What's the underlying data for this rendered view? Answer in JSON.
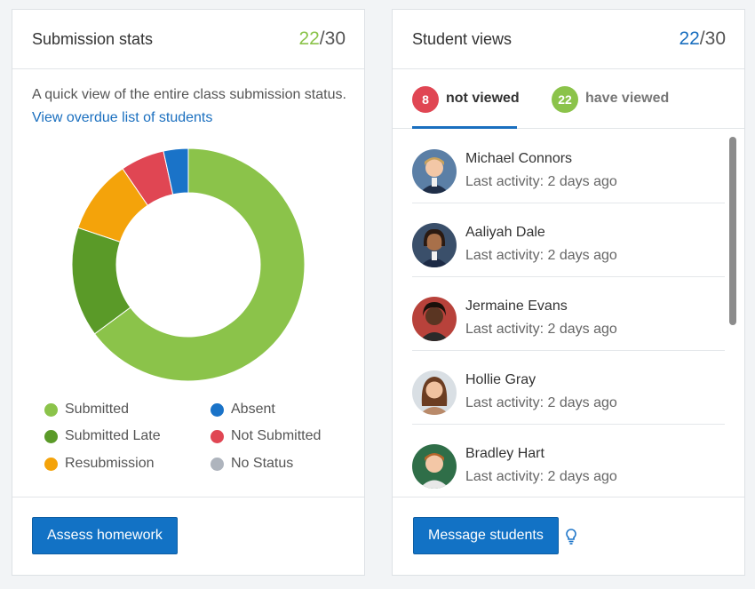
{
  "submission_card": {
    "title": "Submission stats",
    "count": {
      "done": "22",
      "separator": "/",
      "total": "30"
    },
    "description": "A quick view of the entire class submission status.",
    "overdue_link": "View overdue list of students",
    "legend": [
      {
        "label": "Submitted",
        "color": "#8bc34a"
      },
      {
        "label": "Absent",
        "color": "#1a73c8"
      },
      {
        "label": "Submitted Late",
        "color": "#5a9a28"
      },
      {
        "label": "Not Submitted",
        "color": "#e04653"
      },
      {
        "label": "Resubmission",
        "color": "#f4a30a"
      },
      {
        "label": "No Status",
        "color": "#aeb4bd"
      }
    ],
    "donut": [
      {
        "label": "Submitted",
        "value": 17,
        "color": "#8bc34a"
      },
      {
        "label": "Submitted Late",
        "value": 4,
        "color": "#5a9a28"
      },
      {
        "label": "Resubmission",
        "value": 2.7,
        "color": "#f4a30a"
      },
      {
        "label": "Not Submitted",
        "value": 1.6,
        "color": "#e04653"
      },
      {
        "label": "Absent",
        "value": 0.9,
        "color": "#1a73c8"
      }
    ],
    "assess_button": "Assess homework"
  },
  "views_card": {
    "title": "Student views",
    "count": {
      "done": "22",
      "separator": "/",
      "total": "30"
    },
    "tabs": [
      {
        "count": "8",
        "label": "not viewed",
        "badge_color": "#e04653",
        "active": true
      },
      {
        "count": "22",
        "label": "have viewed",
        "badge_color": "#8bc34a",
        "active": false
      }
    ],
    "students": [
      {
        "name": "Michael Connors",
        "activity": "Last activity: 2 days ago",
        "avatar_bg": "#5b7fa6"
      },
      {
        "name": "Aaliyah Dale",
        "activity": "Last activity: 2 days ago",
        "avatar_bg": "#3a4f6a"
      },
      {
        "name": "Jermaine Evans",
        "activity": "Last activity: 2 days ago",
        "avatar_bg": "#b8423b"
      },
      {
        "name": "Hollie Gray",
        "activity": "Last activity: 2 days ago",
        "avatar_bg": "#d9dfe4"
      },
      {
        "name": "Bradley Hart",
        "activity": "Last activity: 2 days ago",
        "avatar_bg": "#2f6e48"
      }
    ],
    "message_button": "Message students",
    "hint_icon": "lightbulb-icon"
  },
  "colors": {
    "accent_green": "#8bc34a",
    "accent_blue": "#1a6fbf",
    "button_blue": "#1272c5"
  }
}
